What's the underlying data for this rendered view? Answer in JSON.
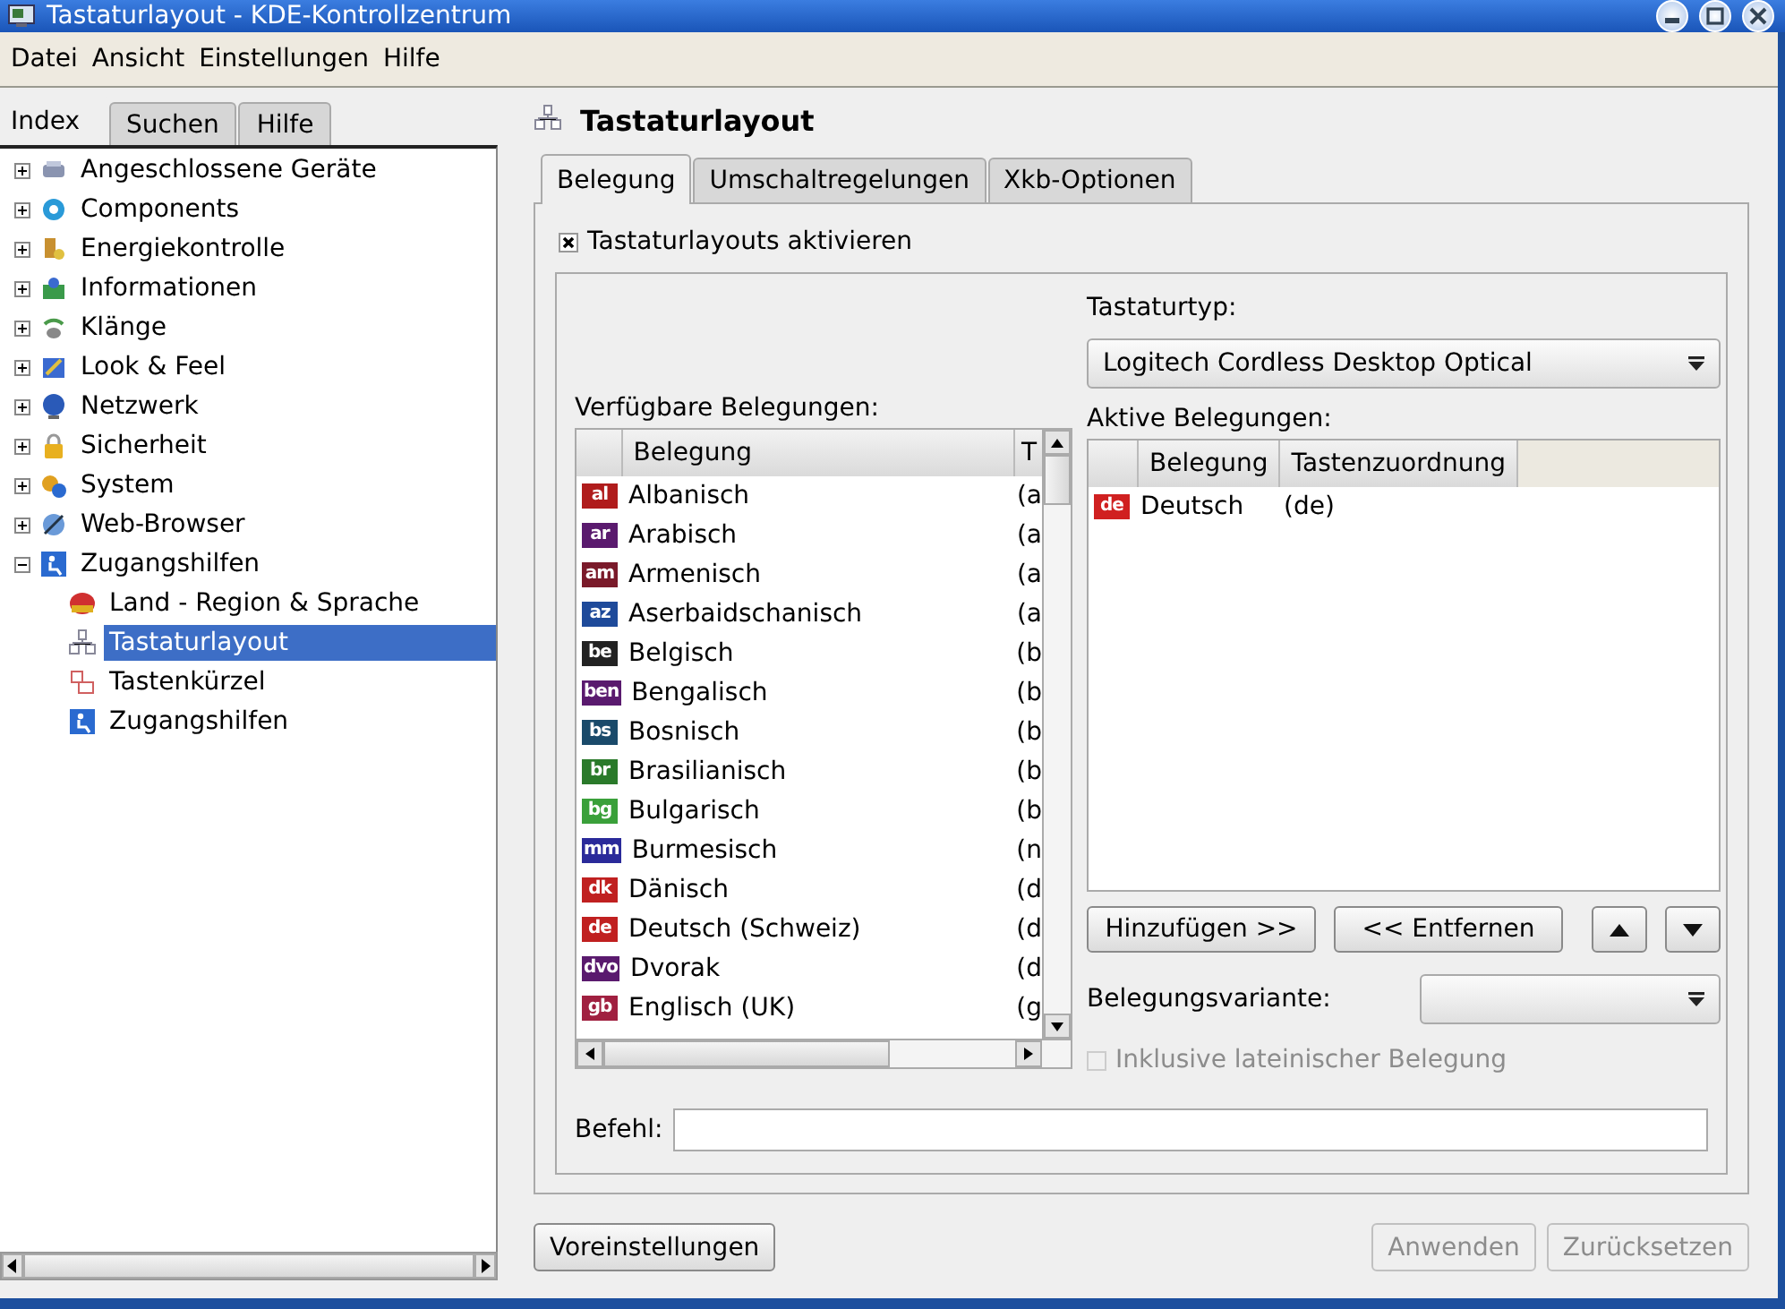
{
  "window": {
    "title": "Tastaturlayout - KDE-Kontrollzentrum"
  },
  "menu": [
    "Datei",
    "Ansicht",
    "Einstellungen",
    "Hilfe"
  ],
  "sidebar": {
    "tabs": [
      {
        "label": "Index",
        "selected": true
      },
      {
        "label": "Suchen",
        "selected": false
      },
      {
        "label": "Hilfe",
        "selected": false
      }
    ],
    "tree": [
      {
        "label": "Angeschlossene Geräte",
        "expanded": false,
        "selected": false
      },
      {
        "label": "Components",
        "expanded": false,
        "selected": false
      },
      {
        "label": "Energiekontrolle",
        "expanded": false,
        "selected": false
      },
      {
        "label": "Informationen",
        "expanded": false,
        "selected": false
      },
      {
        "label": "Klänge",
        "expanded": false,
        "selected": false
      },
      {
        "label": "Look & Feel",
        "expanded": false,
        "selected": false
      },
      {
        "label": "Netzwerk",
        "expanded": false,
        "selected": false
      },
      {
        "label": "Sicherheit",
        "expanded": false,
        "selected": false
      },
      {
        "label": "System",
        "expanded": false,
        "selected": false
      },
      {
        "label": "Web-Browser",
        "expanded": false,
        "selected": false
      },
      {
        "label": "Zugangshilfen",
        "expanded": true,
        "selected": false,
        "children": [
          {
            "label": "Land - Region & Sprache",
            "selected": false
          },
          {
            "label": "Tastaturlayout",
            "selected": true
          },
          {
            "label": "Tastenkürzel",
            "selected": false
          },
          {
            "label": "Zugangshilfen",
            "selected": false
          }
        ]
      }
    ]
  },
  "module": {
    "title": "Tastaturlayout",
    "tabs": [
      {
        "label": "Belegung",
        "selected": true
      },
      {
        "label": "Umschaltregelungen",
        "selected": false
      },
      {
        "label": "Xkb-Optionen",
        "selected": false
      }
    ],
    "enable_checkbox": {
      "label": "Tastaturlayouts aktivieren",
      "checked": true
    },
    "keyboard_type": {
      "label": "Tastaturtyp:",
      "value": "Logitech Cordless Desktop Optical"
    },
    "available": {
      "label": "Verfügbare Belegungen:",
      "columns": [
        "Belegung",
        "T"
      ],
      "rows": [
        {
          "flag": "al",
          "color": "#b01c1c",
          "name": "Albanisch",
          "column_2": "(a"
        },
        {
          "flag": "ar",
          "color": "#5a1a6e",
          "name": "Arabisch",
          "column_2": "(a"
        },
        {
          "flag": "am",
          "color": "#7a1a2a",
          "name": "Armenisch",
          "column_2": "(a"
        },
        {
          "flag": "az",
          "color": "#1e4a9a",
          "name": "Aserbaidschanisch",
          "column_2": "(a"
        },
        {
          "flag": "be",
          "color": "#222222",
          "name": "Belgisch",
          "column_2": "(b"
        },
        {
          "flag": "ben",
          "color": "#5a1a6e",
          "name": "Bengalisch",
          "column_2": "(b"
        },
        {
          "flag": "bs",
          "color": "#1a4a6a",
          "name": "Bosnisch",
          "column_2": "(b"
        },
        {
          "flag": "br",
          "color": "#2a7a2a",
          "name": "Brasilianisch",
          "column_2": "(b"
        },
        {
          "flag": "bg",
          "color": "#3aa03a",
          "name": "Bulgarisch",
          "column_2": "(b"
        },
        {
          "flag": "mm",
          "color": "#2a2a9a",
          "name": "Burmesisch",
          "column_2": "(n"
        },
        {
          "flag": "dk",
          "color": "#c02020",
          "name": "Dänisch",
          "column_2": "(d"
        },
        {
          "flag": "de",
          "color": "#c02020",
          "name": "Deutsch (Schweiz)",
          "column_2": "(d"
        },
        {
          "flag": "dvo",
          "color": "#5a1a6e",
          "name": "Dvorak",
          "column_2": "(d"
        },
        {
          "flag": "gb",
          "color": "#a02040",
          "name": "Englisch (UK)",
          "column_2": "(g"
        }
      ]
    },
    "active": {
      "label": "Aktive Belegungen:",
      "columns": [
        "Belegung",
        "Tastenzuordnung"
      ],
      "rows": [
        {
          "flag": "de",
          "color": "#d02020",
          "name": "Deutsch",
          "map": "(de)"
        }
      ]
    },
    "buttons": [
      "Hinzufügen >>",
      "<< Entfernen"
    ],
    "variant": {
      "label": "Belegungsvariante:"
    },
    "latin_checkbox": {
      "label": "Inklusive lateinischer Belegung",
      "checked": false,
      "disabled": true
    },
    "command": {
      "label": "Befehl:"
    }
  },
  "footer": {
    "buttons": [
      {
        "label": "Voreinstellungen",
        "disabled": false
      },
      {
        "label": "Anwenden",
        "disabled": true
      },
      {
        "label": "Zurücksetzen",
        "disabled": true
      }
    ]
  }
}
